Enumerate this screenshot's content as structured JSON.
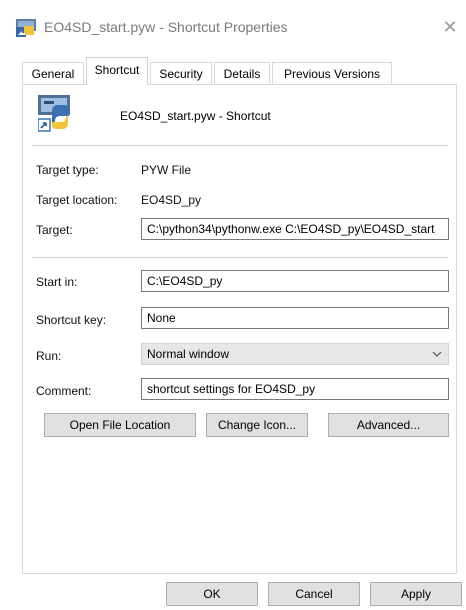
{
  "window": {
    "title": "EO4SD_start.pyw - Shortcut Properties",
    "close_glyph": "✕"
  },
  "tabs": [
    {
      "label": "General"
    },
    {
      "label": "Shortcut"
    },
    {
      "label": "Security"
    },
    {
      "label": "Details"
    },
    {
      "label": "Previous Versions"
    }
  ],
  "header": {
    "shortcut_name": "EO4SD_start.pyw - Shortcut"
  },
  "fields": {
    "target_type_label": "Target type:",
    "target_type_value": "PYW File",
    "target_location_label": "Target location:",
    "target_location_value": "EO4SD_py",
    "target_label": "Target:",
    "target_value": "C:\\python34\\pythonw.exe C:\\EO4SD_py\\EO4SD_start",
    "start_in_label": "Start in:",
    "start_in_value": "C:\\EO4SD_py",
    "shortcut_key_label": "Shortcut key:",
    "shortcut_key_value": "None",
    "run_label": "Run:",
    "run_value": "Normal window",
    "comment_label": "Comment:",
    "comment_value": "shortcut settings for EO4SD_py"
  },
  "actions": {
    "open_file_location": "Open File Location",
    "change_icon": "Change Icon...",
    "advanced": "Advanced..."
  },
  "footer": {
    "ok": "OK",
    "cancel": "Cancel",
    "apply": "Apply"
  }
}
